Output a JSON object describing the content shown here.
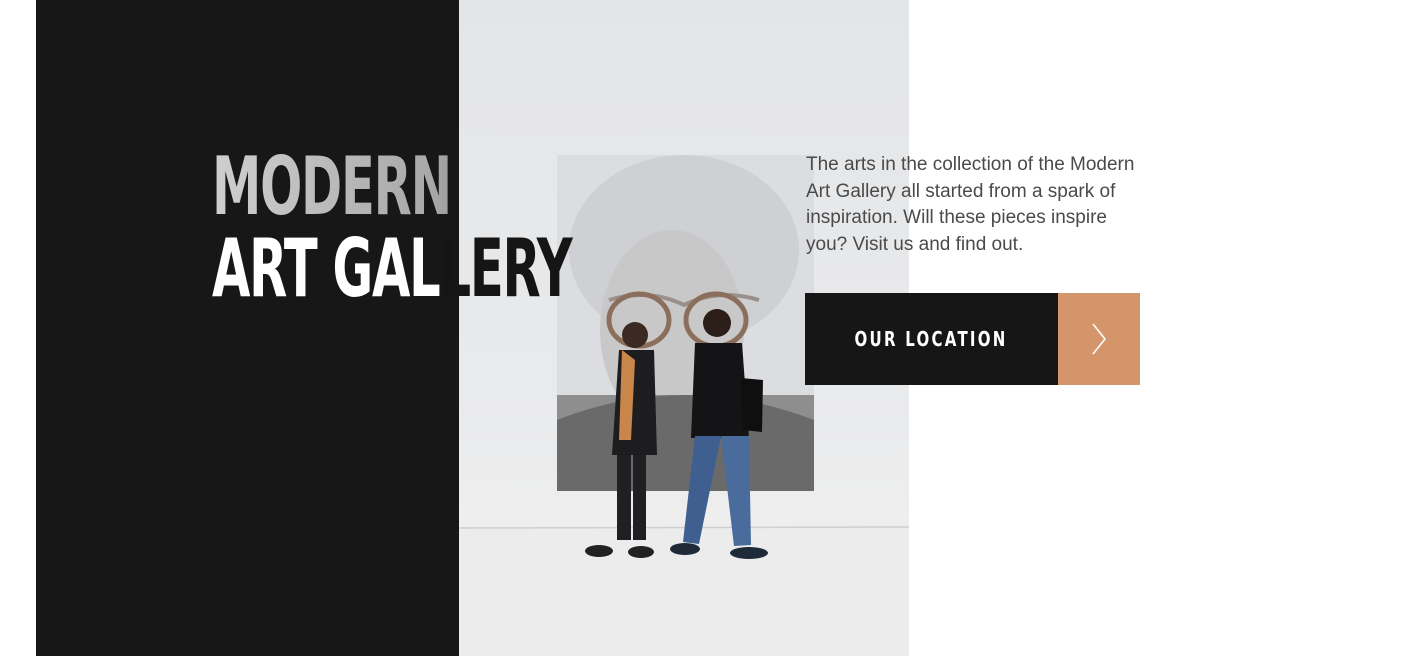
{
  "hero": {
    "title_line_1": "MODERN",
    "title_line_2_light": "ART GAL",
    "title_line_2_dark": "LERY",
    "description": "The arts in the collection of the Modern Art Gallery all started from a spark of inspiration. Will these pieces inspire you? Visit us and find out.",
    "cta_label": "OUR LOCATION",
    "cta_icon": "chevron-right-icon",
    "image_subject": "gallery-visitors-portrait-photo"
  },
  "colors": {
    "dark_panel": "#171717",
    "accent": "#d4956a",
    "text": "#4a4a4a"
  }
}
